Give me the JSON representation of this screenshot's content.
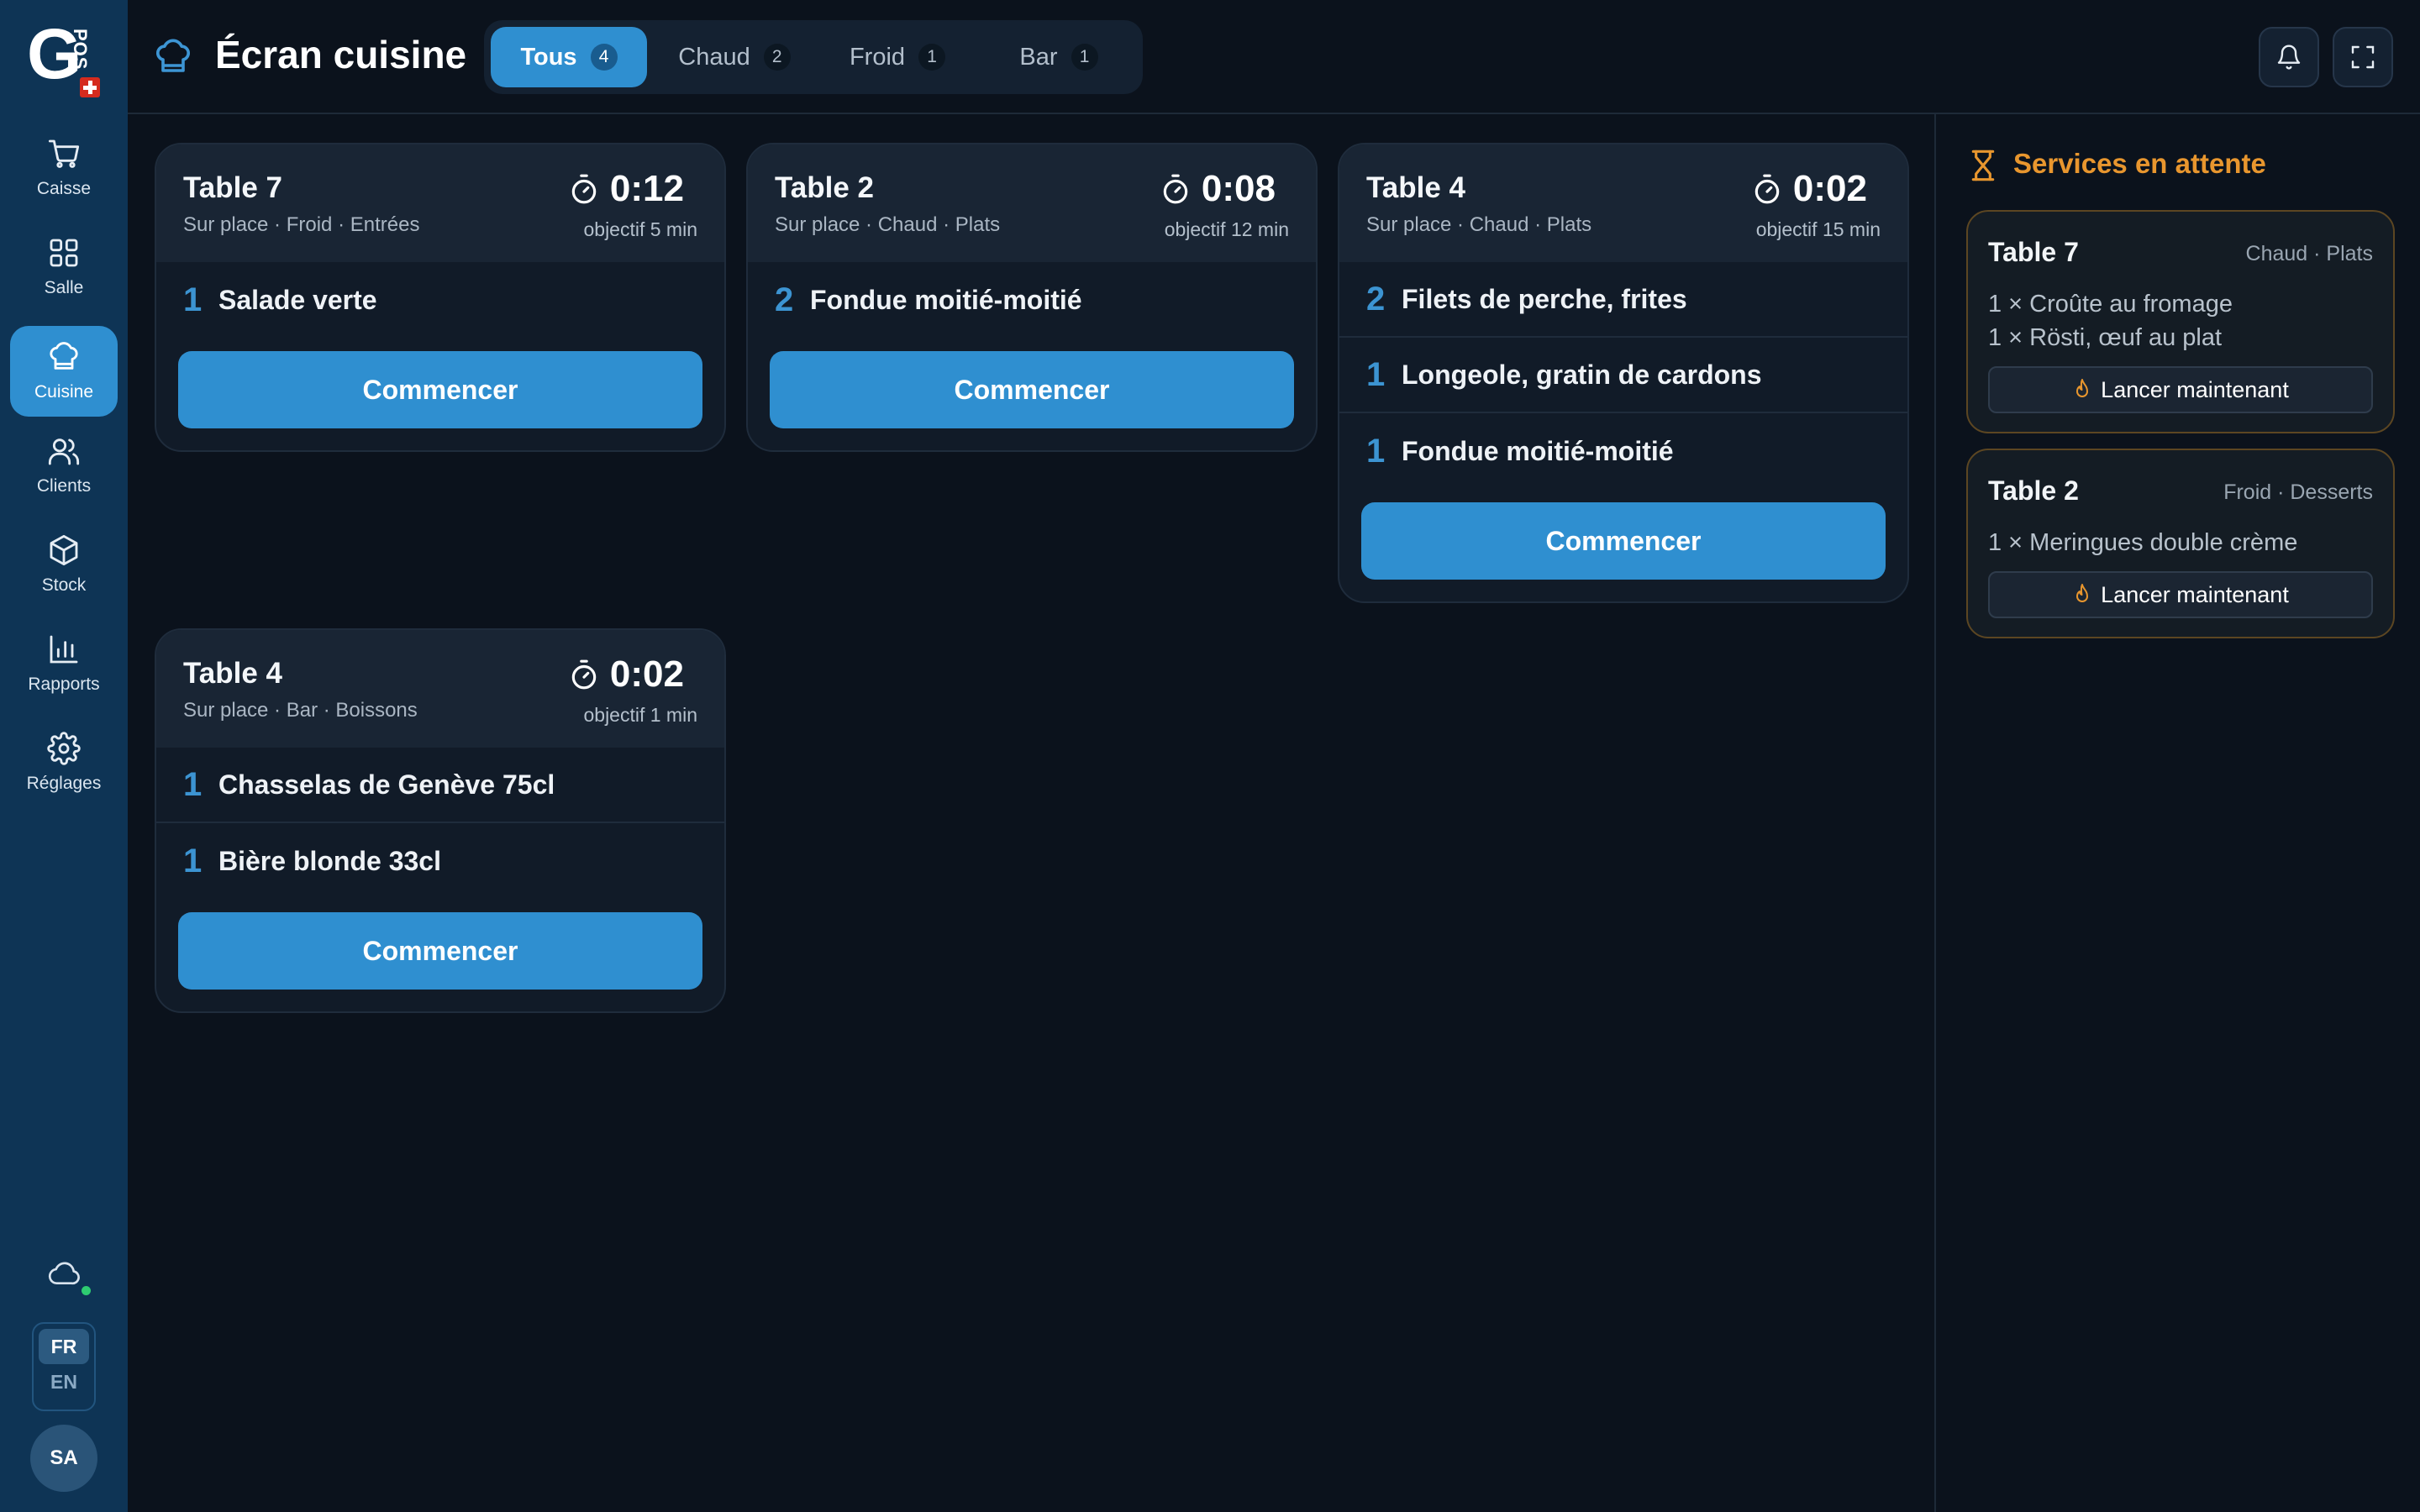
{
  "brand": {
    "logo_letter": "G",
    "logo_suffix": "POS"
  },
  "sidebar": {
    "items": [
      {
        "label": "Caisse",
        "icon": "cart-icon",
        "active": false
      },
      {
        "label": "Salle",
        "icon": "grid-icon",
        "active": false
      },
      {
        "label": "Cuisine",
        "icon": "chef-hat-icon",
        "active": true
      },
      {
        "label": "Clients",
        "icon": "users-icon",
        "active": false
      },
      {
        "label": "Stock",
        "icon": "box-icon",
        "active": false
      },
      {
        "label": "Rapports",
        "icon": "bar-chart-icon",
        "active": false
      },
      {
        "label": "Réglages",
        "icon": "gear-icon",
        "active": false
      }
    ],
    "sync_status": "online",
    "languages": [
      "FR",
      "EN"
    ],
    "active_language": "FR",
    "user_initials": "SA"
  },
  "header": {
    "title": "Écran cuisine",
    "tabs": [
      {
        "label": "Tous",
        "count": "4",
        "active": true
      },
      {
        "label": "Chaud",
        "count": "2",
        "active": false
      },
      {
        "label": "Froid",
        "count": "1",
        "active": false
      },
      {
        "label": "Bar",
        "count": "1",
        "active": false
      }
    ]
  },
  "tickets": [
    {
      "table": "Table 7",
      "subtitle": "Sur place · Froid · Entrées",
      "timer": "0:12",
      "objective": "objectif 5 min",
      "items": [
        {
          "qty": "1",
          "name": "Salade verte"
        }
      ],
      "action": "Commencer"
    },
    {
      "table": "Table 2",
      "subtitle": "Sur place · Chaud · Plats",
      "timer": "0:08",
      "objective": "objectif 12 min",
      "items": [
        {
          "qty": "2",
          "name": "Fondue moitié-moitié"
        }
      ],
      "action": "Commencer"
    },
    {
      "table": "Table 4",
      "subtitle": "Sur place · Chaud · Plats",
      "timer": "0:02",
      "objective": "objectif 15 min",
      "items": [
        {
          "qty": "2",
          "name": "Filets de perche, frites"
        },
        {
          "qty": "1",
          "name": "Longeole, gratin de cardons"
        },
        {
          "qty": "1",
          "name": "Fondue moitié-moitié"
        }
      ],
      "action": "Commencer"
    },
    {
      "table": "Table 4",
      "subtitle": "Sur place · Bar · Boissons",
      "timer": "0:02",
      "objective": "objectif 1 min",
      "items": [
        {
          "qty": "1",
          "name": "Chasselas de Genève 75cl"
        },
        {
          "qty": "1",
          "name": "Bière blonde 33cl"
        }
      ],
      "action": "Commencer"
    }
  ],
  "waiting": {
    "title": "Services en attente",
    "services": [
      {
        "table": "Table 7",
        "category": "Chaud · Plats",
        "lines": [
          "1 × Croûte au fromage",
          "1 × Rösti, œuf au plat"
        ],
        "action": "Lancer maintenant"
      },
      {
        "table": "Table 2",
        "category": "Froid · Desserts",
        "lines": [
          "1 × Meringues double crème"
        ],
        "action": "Lancer maintenant"
      }
    ]
  },
  "colors": {
    "accent": "#2f8fd0",
    "sidebar": "#0e3455",
    "background": "#0b121c",
    "warning": "#e8962e",
    "online": "#2ecc71"
  }
}
